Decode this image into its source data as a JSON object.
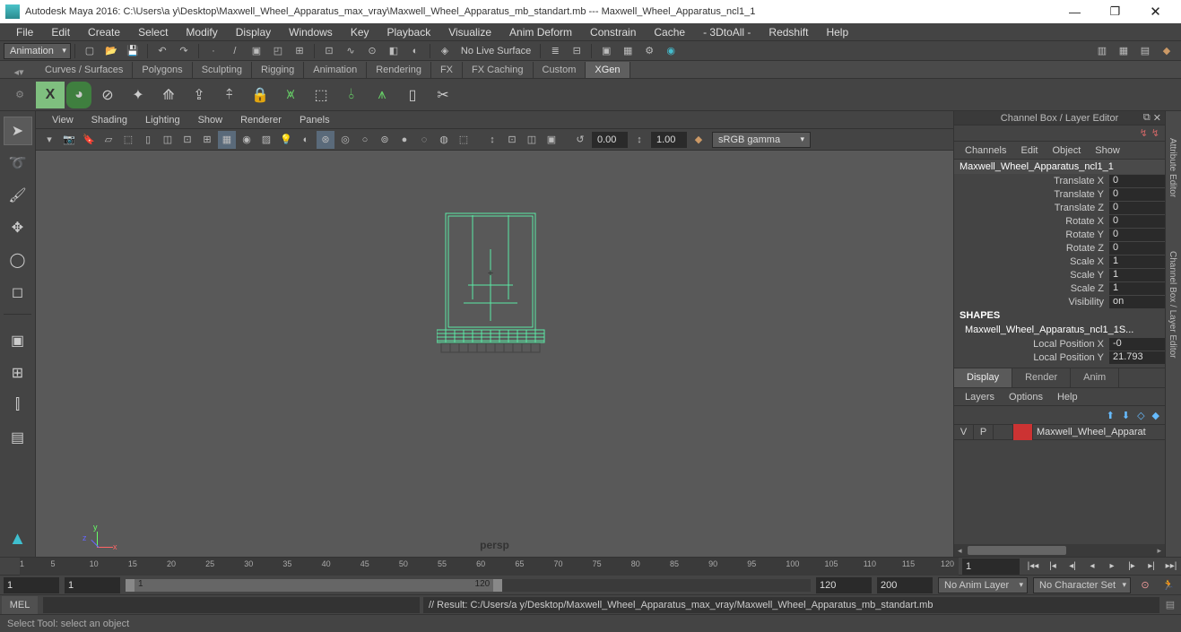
{
  "titlebar": {
    "text": "Autodesk Maya 2016: C:\\Users\\a y\\Desktop\\Maxwell_Wheel_Apparatus_max_vray\\Maxwell_Wheel_Apparatus_mb_standart.mb   ---   Maxwell_Wheel_Apparatus_ncl1_1"
  },
  "menu": [
    "File",
    "Edit",
    "Create",
    "Select",
    "Modify",
    "Display",
    "Windows",
    "Key",
    "Playback",
    "Visualize",
    "Anim Deform",
    "Constrain",
    "Cache",
    "- 3DtoAll -",
    "Redshift",
    "Help"
  ],
  "workspace": {
    "dropdown": "Animation",
    "surface": "No Live Surface"
  },
  "shelf_tabs": [
    "Curves / Surfaces",
    "Polygons",
    "Sculpting",
    "Rigging",
    "Animation",
    "Rendering",
    "FX",
    "FX Caching",
    "Custom",
    "XGen"
  ],
  "shelf_active": "XGen",
  "panel_menu": [
    "View",
    "Shading",
    "Lighting",
    "Show",
    "Renderer",
    "Panels"
  ],
  "paneltb": {
    "v0": "0.00",
    "v1": "1.00",
    "gamma": "sRGB gamma"
  },
  "viewport": {
    "camera": "persp"
  },
  "channel": {
    "title": "Channel Box / Layer Editor",
    "menus": [
      "Channels",
      "Edit",
      "Object",
      "Show"
    ],
    "object": "Maxwell_Wheel_Apparatus_ncl1_1",
    "attrs": [
      {
        "lab": "Translate X",
        "val": "0"
      },
      {
        "lab": "Translate Y",
        "val": "0"
      },
      {
        "lab": "Translate Z",
        "val": "0"
      },
      {
        "lab": "Rotate X",
        "val": "0"
      },
      {
        "lab": "Rotate Y",
        "val": "0"
      },
      {
        "lab": "Rotate Z",
        "val": "0"
      },
      {
        "lab": "Scale X",
        "val": "1"
      },
      {
        "lab": "Scale Y",
        "val": "1"
      },
      {
        "lab": "Scale Z",
        "val": "1"
      },
      {
        "lab": "Visibility",
        "val": "on"
      }
    ],
    "shapes_label": "SHAPES",
    "shape_name": "Maxwell_Wheel_Apparatus_ncl1_1S...",
    "shape_attrs": [
      {
        "lab": "Local Position X",
        "val": "-0"
      },
      {
        "lab": "Local Position Y",
        "val": "21.793"
      }
    ]
  },
  "layers": {
    "tabs": [
      "Display",
      "Render",
      "Anim"
    ],
    "active": "Display",
    "menu": [
      "Layers",
      "Options",
      "Help"
    ],
    "layer": {
      "v": "V",
      "p": "P",
      "color": "#c33",
      "name": "Maxwell_Wheel_Apparat"
    }
  },
  "sidestrip": {
    "attr": "Attribute Editor",
    "cb": "Channel Box / Layer Editor"
  },
  "timeline": {
    "ticks": [
      1,
      5,
      10,
      15,
      20,
      25,
      30,
      35,
      40,
      45,
      50,
      55,
      60,
      65,
      70,
      75,
      80,
      85,
      90,
      95,
      100,
      105,
      110,
      115,
      120
    ],
    "current": "1"
  },
  "range": {
    "start_all": "1",
    "start": "1",
    "lab_start": "1",
    "lab_end": "120",
    "end": "120",
    "end_all": "200",
    "animlayer": "No Anim Layer",
    "charset": "No Character Set"
  },
  "cmd": {
    "lang": "MEL",
    "result": "// Result: C:/Users/a y/Desktop/Maxwell_Wheel_Apparatus_max_vray/Maxwell_Wheel_Apparatus_mb_standart.mb"
  },
  "help": "Select Tool: select an object"
}
